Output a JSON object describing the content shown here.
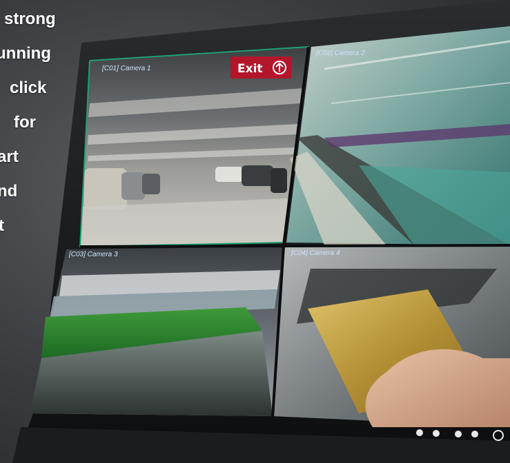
{
  "promo": {
    "lines": [
      "strong",
      "unning",
      "click",
      "for",
      "art",
      "nd",
      "t"
    ]
  },
  "monitor": {
    "cameras": [
      {
        "label": "[C01] Camera 1",
        "scene": "parking-garage"
      },
      {
        "label": "[C02] Camera 2",
        "scene": "subway-platform"
      },
      {
        "label": "[C03] Camera 3",
        "scene": "stadium"
      },
      {
        "label": "[C04] Camera 4",
        "scene": "atm-card-slot"
      }
    ],
    "exit_sign": "Exit",
    "exit_icon": "arrow-up-circle-icon",
    "colors": {
      "bezel": "#141517",
      "frame_highlight": "#1f9e73",
      "exit_sign": "#b3152a",
      "card": "#c9a84a"
    }
  }
}
